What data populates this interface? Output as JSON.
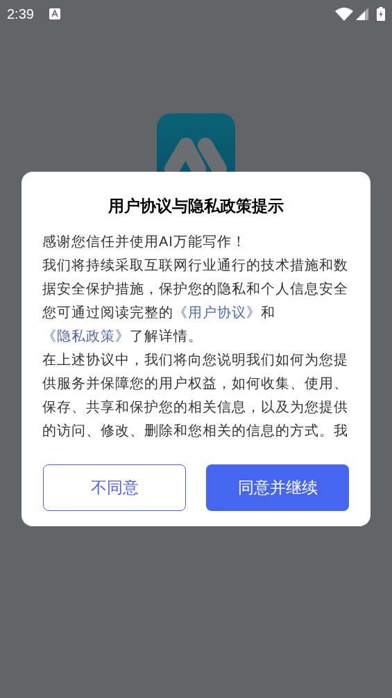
{
  "status_bar": {
    "time": "2:39"
  },
  "dialog": {
    "title": "用户协议与隐私政策提示",
    "paragraphs": [
      {
        "segments": [
          {
            "kind": "plain",
            "text": "感谢您信任并使用AI万能写作！"
          }
        ]
      },
      {
        "segments": [
          {
            "kind": "plain",
            "text": "我们将持续采取互联网行业通行的技术措施和数据安全保护措施，保护您的隐私和个人信息安全"
          }
        ]
      },
      {
        "segments": [
          {
            "kind": "plain",
            "text": "您可通过阅读完整的"
          },
          {
            "kind": "link",
            "text": "《用户协议》"
          },
          {
            "kind": "plain",
            "text": "和"
          },
          {
            "kind": "link",
            "text": "《隐私政策》"
          },
          {
            "kind": "plain",
            "text": "了解详情。"
          }
        ]
      },
      {
        "segments": [
          {
            "kind": "plain",
            "text": "在上述协议中，我们将向您说明我们如何为您提供服务并保障您的用户权益，如何收集、使用、保存、共享和保护您的相关信息，以及为您提供的访问、修改、删除和您相关的信息的方式。我"
          }
        ]
      }
    ],
    "buttons": [
      {
        "kind": "secondary",
        "label": "不同意"
      },
      {
        "kind": "primary",
        "label": "同意并继续"
      }
    ]
  }
}
